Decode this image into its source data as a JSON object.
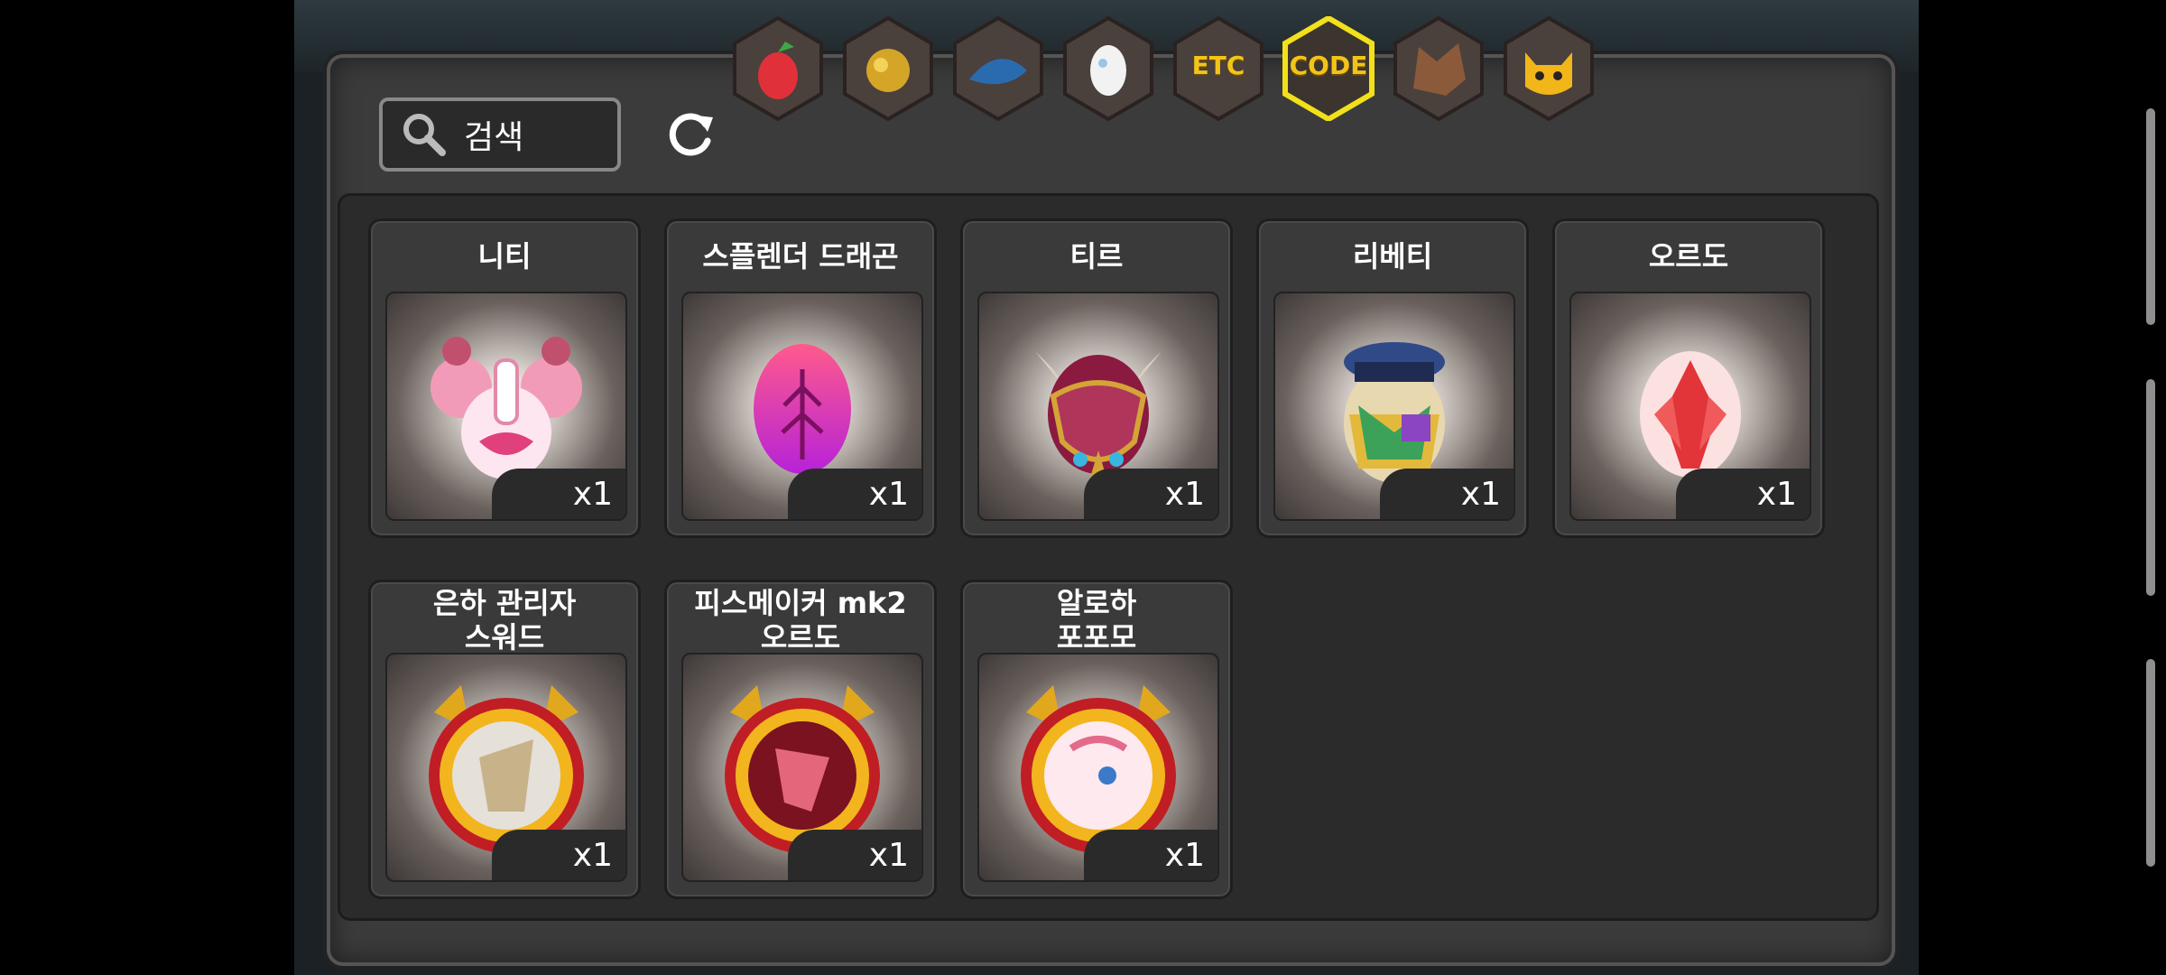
{
  "search": {
    "placeholder": "검색"
  },
  "tabs": [
    {
      "name": "fruit",
      "label": ""
    },
    {
      "name": "gold-ore",
      "label": ""
    },
    {
      "name": "blue-scale",
      "label": ""
    },
    {
      "name": "egg",
      "label": ""
    },
    {
      "name": "etc",
      "label": "ETC"
    },
    {
      "name": "code",
      "label": "CODE",
      "selected": true
    },
    {
      "name": "wolf",
      "label": ""
    },
    {
      "name": "cat-mask",
      "label": ""
    }
  ],
  "items": [
    {
      "name": "니티",
      "count": "x1"
    },
    {
      "name": "스플렌더 드래곤",
      "count": "x1"
    },
    {
      "name": "티르",
      "count": "x1"
    },
    {
      "name": "리베티",
      "count": "x1"
    },
    {
      "name": "오르도",
      "count": "x1"
    },
    {
      "name_line1": "은하 관리자",
      "name_line2": "스워드",
      "count": "x1"
    },
    {
      "name_line1": "피스메이커 mk2",
      "name_line2": "오르도",
      "count": "x1"
    },
    {
      "name_line1": "알로하",
      "name_line2": "포포모",
      "count": "x1"
    }
  ]
}
